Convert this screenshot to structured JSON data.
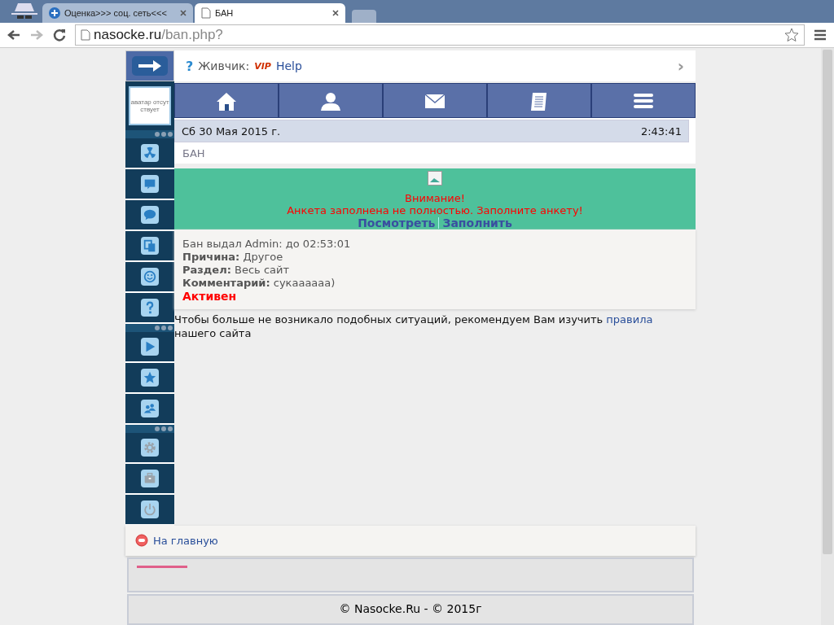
{
  "browser": {
    "tabs": [
      {
        "title": "Оценка>>> соц. сеть<<<",
        "selected": false,
        "kind": "site"
      },
      {
        "title": "БАН",
        "selected": true,
        "kind": "page"
      }
    ],
    "address": {
      "host": "nasocke.ru",
      "path": "/ban.php?"
    }
  },
  "sidebar": {
    "avatar": "аватар отсутствует",
    "groups": [
      [
        {
          "kind": "radiation"
        },
        {
          "kind": "message"
        },
        {
          "kind": "chat"
        },
        {
          "kind": "copy"
        },
        {
          "kind": "smile"
        },
        {
          "kind": "help"
        }
      ],
      [
        {
          "kind": "play"
        },
        {
          "kind": "star"
        },
        {
          "kind": "people"
        }
      ],
      [
        {
          "kind": "gear"
        },
        {
          "kind": "case"
        },
        {
          "kind": "power"
        }
      ]
    ]
  },
  "header": {
    "mark": "?",
    "name": "Живчик:",
    "vip": "VIP",
    "link": "Help",
    "chevron": "›"
  },
  "nav": [
    {
      "kind": "home"
    },
    {
      "kind": "person"
    },
    {
      "kind": "mail"
    },
    {
      "kind": "scroll"
    },
    {
      "kind": "menu"
    }
  ],
  "date": "Сб 30 Мая 2015 г.",
  "time": "2:43:41",
  "page_title": "БАН",
  "alert": {
    "title": "Внимание!",
    "message": "Анкета заполнена не полностью. Заполните анкету!",
    "links": [
      "Посмотреть",
      "Заполнить"
    ]
  },
  "ban": {
    "issued": "Бан выдал Admin: до 02:53:01",
    "fields": [
      {
        "label": "Причина:",
        "value": "Другое"
      },
      {
        "label": "Раздел:",
        "value": "Весь сайт"
      },
      {
        "label": "Комментарий:",
        "value": "сукаааааа)"
      }
    ],
    "status": "Активен"
  },
  "notice": {
    "before": "Чтобы больше не возникало подобных ситуаций, рекомендуем Вам изучить",
    "link": "правила",
    "after": "нашего сайта"
  },
  "footer_link": "На главную",
  "copyright": "© Nasocke.Ru - © 2015г"
}
